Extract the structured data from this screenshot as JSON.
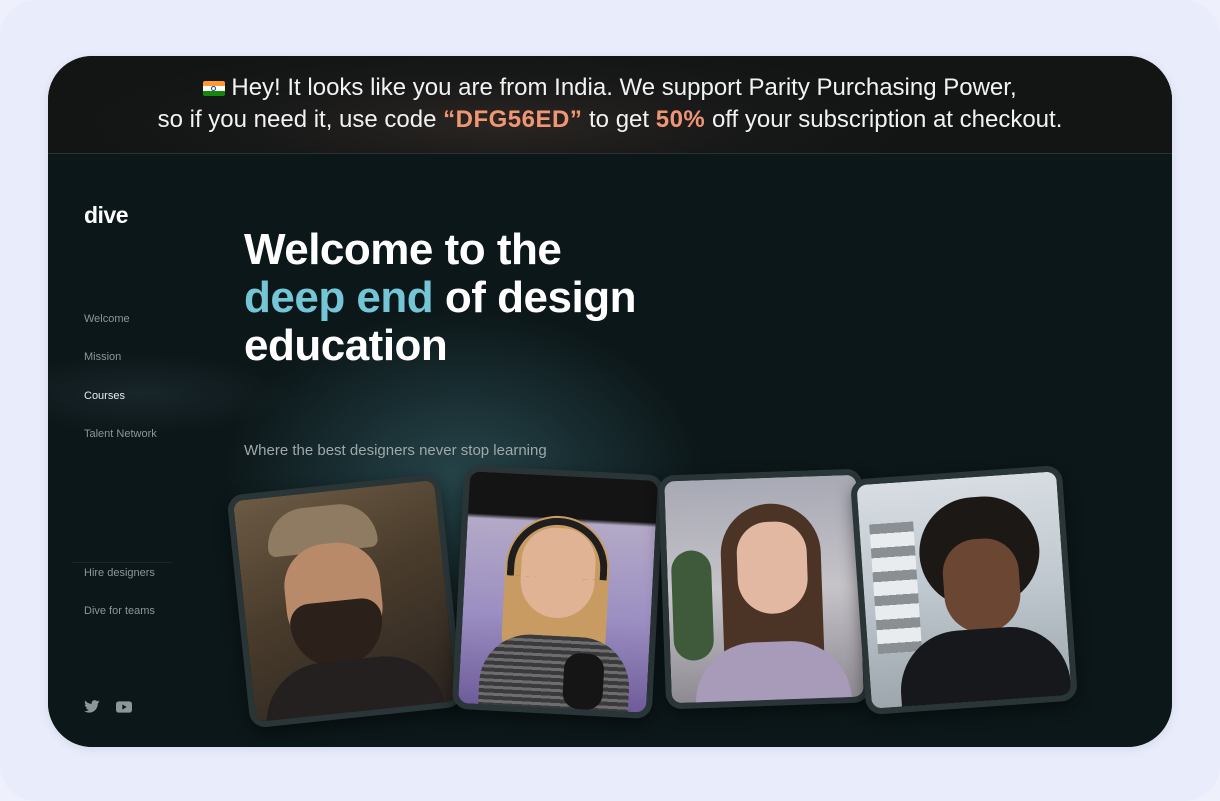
{
  "banner": {
    "line1": "Hey! It looks like you are from India. We support Parity Purchasing Power,",
    "line2_prefix": "so if you need it, use code",
    "code": "“DFG56ED”",
    "line2_mid": "to get",
    "discount": "50%",
    "line2_suffix": "off your subscription at checkout.",
    "flag_icon": "india-flag-icon"
  },
  "sidebar": {
    "logo": "dive",
    "items": [
      {
        "label": "Welcome"
      },
      {
        "label": "Mission"
      },
      {
        "label": "Courses"
      },
      {
        "label": "Talent Network"
      }
    ],
    "secondary": [
      {
        "label": "Hire designers"
      },
      {
        "label": "Dive for teams"
      }
    ],
    "social_icons": [
      "twitter-icon",
      "youtube-icon"
    ]
  },
  "hero": {
    "title_line1": "Welcome to the",
    "title_accent": "deep end",
    "title_line2_rest": "of design",
    "title_line3": "education",
    "subtitle": "Where the best designers never stop learning"
  },
  "colors": {
    "accent": "#74c6d6",
    "highlight": "#f19674",
    "background": "#0c1719"
  }
}
